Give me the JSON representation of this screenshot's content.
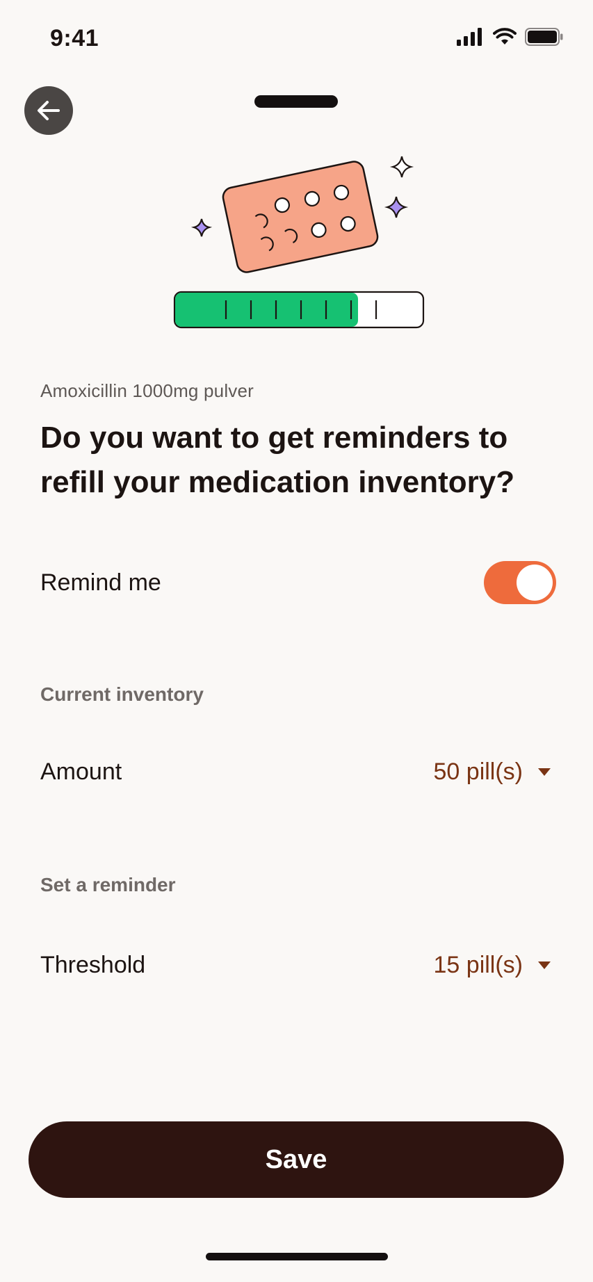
{
  "status_bar": {
    "time": "9:41"
  },
  "header": {
    "back_icon": "arrow-left-icon"
  },
  "illustration": {
    "icon": "pill-blister-pack",
    "refill_progress": 0.74
  },
  "medication": {
    "name": "Amoxicillin 1000mg pulver"
  },
  "question": "Do you want to get reminders to refill your medication inventory?",
  "remind": {
    "label": "Remind me",
    "enabled": true
  },
  "inventory": {
    "section_title": "Current inventory",
    "label": "Amount",
    "value": "50 pill(s)"
  },
  "reminder": {
    "section_title": "Set a reminder",
    "label": "Threshold",
    "value": "15 pill(s)"
  },
  "actions": {
    "save_label": "Save"
  },
  "colors": {
    "accent": "#ee6b3c",
    "primary": "#2e1410",
    "value_text": "#7a3414",
    "progress": "#16c172",
    "pill_pack": "#f6a488"
  }
}
